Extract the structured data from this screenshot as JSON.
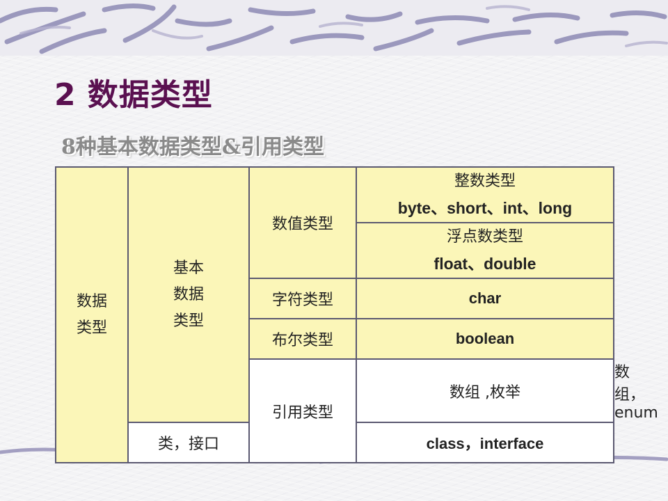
{
  "slide": {
    "title": "2 数据类型",
    "subtitle": "8种基本数据类型&引用类型"
  },
  "table": {
    "root": [
      "数据",
      "类型"
    ],
    "basic": [
      "基本",
      "数据",
      "类型"
    ],
    "reference": "引用类型",
    "numeric": "数值类型",
    "integer_label": "整数类型",
    "integer_values": "byte、short、int、long",
    "float_label": "浮点数类型",
    "float_values": "float、double",
    "char_label": "字符类型",
    "char_value": "char",
    "bool_label": "布尔类型",
    "bool_value": "boolean",
    "array_enum_label": "数组 ,枚举",
    "array_enum_value": "数组，enum",
    "class_label": "类，接口",
    "class_value": "class，interface"
  },
  "colors": {
    "title": "#5a1050",
    "cell_yellow": "#fbf6b8",
    "border": "#5a5870"
  }
}
